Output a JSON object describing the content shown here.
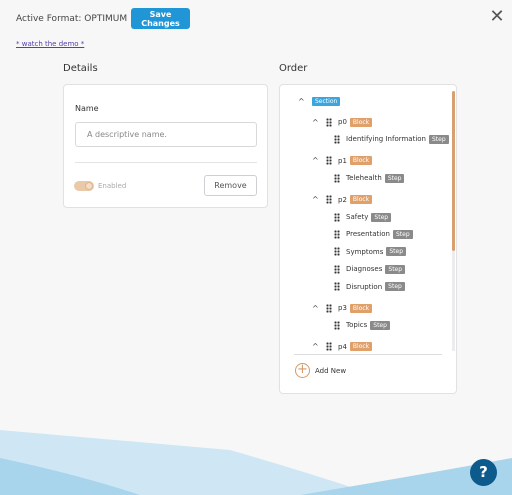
{
  "header": {
    "active_format": "Active Format: OPTIMUM",
    "save_label": "Save Changes",
    "close_icon": "close-icon",
    "demo_link": "* watch the demo *"
  },
  "details": {
    "title": "Details",
    "name_label": "Name",
    "name_placeholder": "A descriptive name.",
    "enabled_label": "Enabled",
    "enabled_on": true,
    "remove_label": "Remove"
  },
  "order": {
    "title": "Order",
    "section": {
      "badge": "Section"
    },
    "blocks": [
      {
        "label": "p0",
        "badge": "Block",
        "steps": [
          {
            "label": "Identifying Information",
            "badge": "Step"
          }
        ]
      },
      {
        "label": "p1",
        "badge": "Block",
        "steps": [
          {
            "label": "Telehealth",
            "badge": "Step"
          }
        ]
      },
      {
        "label": "p2",
        "badge": "Block",
        "steps": [
          {
            "label": "Safety",
            "badge": "Step"
          },
          {
            "label": "Presentation",
            "badge": "Step"
          },
          {
            "label": "Symptoms",
            "badge": "Step"
          },
          {
            "label": "Diagnoses",
            "badge": "Step"
          },
          {
            "label": "Disruption",
            "badge": "Step"
          }
        ]
      },
      {
        "label": "p3",
        "badge": "Block",
        "steps": [
          {
            "label": "Topics",
            "badge": "Step"
          }
        ]
      },
      {
        "label": "p4",
        "badge": "Block",
        "steps": []
      }
    ],
    "add_label": "Add New"
  },
  "help_label": "?",
  "colors": {
    "primary": "#2196d6",
    "accent": "#e0a06a",
    "wave": "#a8d4ec",
    "help": "#0d5a8c"
  }
}
